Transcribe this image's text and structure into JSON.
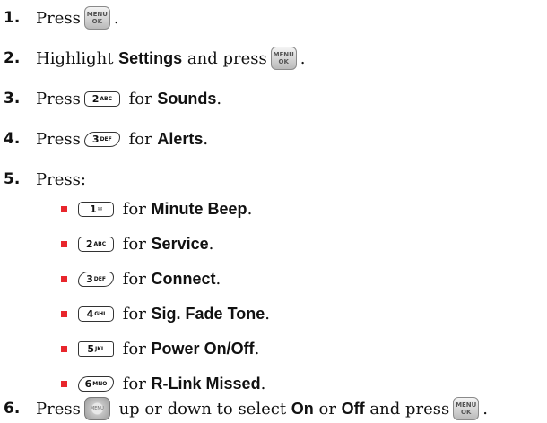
{
  "steps": [
    {
      "n": "1.",
      "pre": "Press",
      "post": "."
    },
    {
      "n": "2.",
      "pre": "Highlight ",
      "bold": "Settings",
      "mid": " and press",
      "post": "."
    },
    {
      "n": "3.",
      "pre": "Press",
      "key": "2",
      "key_sub": "ABC",
      "for": " for ",
      "bold": "Sounds",
      "post": "."
    },
    {
      "n": "4.",
      "pre": "Press",
      "key": "3",
      "key_sub": "DEF",
      "for": " for ",
      "bold": "Alerts",
      "post": "."
    },
    {
      "n": "5.",
      "pre": "Press:"
    },
    {
      "n": "6.",
      "pre": "Press",
      "mid": " up or down to select ",
      "bold1": "On",
      "or": " or ",
      "bold2": "Off",
      "and": " and press",
      "post": "."
    }
  ],
  "menu_key": {
    "line1": "MENU",
    "line2": "OK"
  },
  "nav_key": {
    "label": "MENU"
  },
  "sub_items": [
    {
      "key": "1",
      "key_sub": "✉",
      "for": " for ",
      "bold": "Minute Beep",
      "post": "."
    },
    {
      "key": "2",
      "key_sub": "ABC",
      "for": " for ",
      "bold": "Service",
      "post": "."
    },
    {
      "key": "3",
      "key_sub": "DEF",
      "for": " for ",
      "bold": "Connect",
      "post": "."
    },
    {
      "key": "4",
      "key_sub": "GHI",
      "for": " for ",
      "bold": "Sig. Fade Tone",
      "post": "."
    },
    {
      "key": "5",
      "key_sub": "JKL",
      "for": " for ",
      "bold": "Power On/Off",
      "post": "."
    },
    {
      "key": "6",
      "key_sub": "MNO",
      "for": " for ",
      "bold": "R-Link Missed",
      "post": "."
    }
  ],
  "colors": {
    "bullet": "#e8262c"
  }
}
